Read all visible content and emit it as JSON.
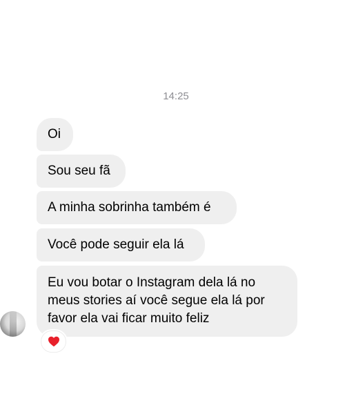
{
  "timestamp": "14:25",
  "messages": [
    {
      "text": "Oi"
    },
    {
      "text": "Sou seu fã"
    },
    {
      "text": "A minha sobrinha também é"
    },
    {
      "text": "Você pode seguir ela lá"
    },
    {
      "text": "Eu vou botar o Instagram dela lá no meus stories aí você segue ela lá por favor ela vai ficar muito feliz"
    }
  ],
  "reaction": {
    "icon": "red-heart-icon",
    "color": "#e8202b"
  },
  "bubble_color": "#efefef"
}
